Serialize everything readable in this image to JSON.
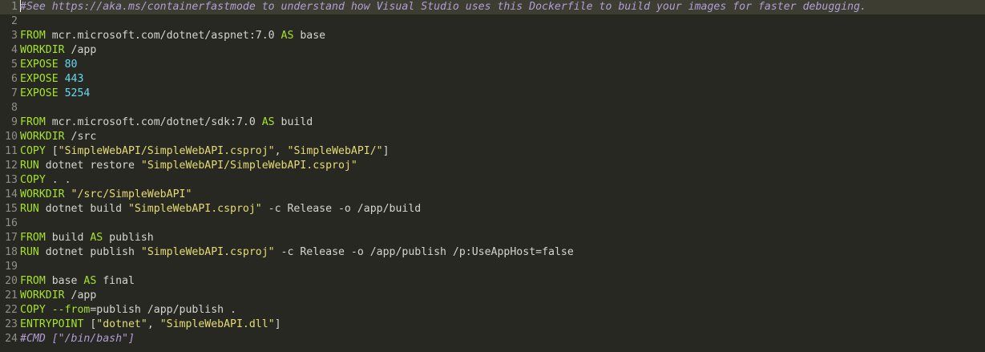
{
  "editor": {
    "language": "dockerfile",
    "current_line": 1,
    "colors": {
      "background": "#272822",
      "gutter_text": "#8f908a",
      "current_line_bg": "#3e3d32",
      "keyword": "#a6e22e",
      "string": "#e6db74",
      "number": "#66d9ef",
      "comment": "#b29ed6",
      "text": "#d5d5d0"
    },
    "lines": [
      {
        "n": "1",
        "tokens": [
          {
            "t": "cmt",
            "v": "#See https://aka.ms/containerfastmode to understand how Visual Studio uses this Dockerfile to build your images for faster debugging."
          }
        ]
      },
      {
        "n": "2",
        "tokens": []
      },
      {
        "n": "3",
        "tokens": [
          {
            "t": "kw",
            "v": "FROM"
          },
          {
            "t": "txt",
            "v": " mcr.microsoft.com/dotnet/aspnet:7.0 "
          },
          {
            "t": "kw",
            "v": "AS"
          },
          {
            "t": "txt",
            "v": " base"
          }
        ]
      },
      {
        "n": "4",
        "tokens": [
          {
            "t": "kw",
            "v": "WORKDIR"
          },
          {
            "t": "txt",
            "v": " /app"
          }
        ]
      },
      {
        "n": "5",
        "tokens": [
          {
            "t": "kw",
            "v": "EXPOSE"
          },
          {
            "t": "txt",
            "v": " "
          },
          {
            "t": "num",
            "v": "80"
          }
        ]
      },
      {
        "n": "6",
        "tokens": [
          {
            "t": "kw",
            "v": "EXPOSE"
          },
          {
            "t": "txt",
            "v": " "
          },
          {
            "t": "num",
            "v": "443"
          }
        ]
      },
      {
        "n": "7",
        "tokens": [
          {
            "t": "kw",
            "v": "EXPOSE"
          },
          {
            "t": "txt",
            "v": " "
          },
          {
            "t": "num",
            "v": "5254"
          }
        ]
      },
      {
        "n": "8",
        "tokens": []
      },
      {
        "n": "9",
        "tokens": [
          {
            "t": "kw",
            "v": "FROM"
          },
          {
            "t": "txt",
            "v": " mcr.microsoft.com/dotnet/sdk:7.0 "
          },
          {
            "t": "kw",
            "v": "AS"
          },
          {
            "t": "txt",
            "v": " build"
          }
        ]
      },
      {
        "n": "10",
        "tokens": [
          {
            "t": "kw",
            "v": "WORKDIR"
          },
          {
            "t": "txt",
            "v": " /src"
          }
        ]
      },
      {
        "n": "11",
        "tokens": [
          {
            "t": "kw",
            "v": "COPY"
          },
          {
            "t": "txt",
            "v": " ["
          },
          {
            "t": "str",
            "v": "\"SimpleWebAPI/SimpleWebAPI.csproj\""
          },
          {
            "t": "txt",
            "v": ", "
          },
          {
            "t": "str",
            "v": "\"SimpleWebAPI/\""
          },
          {
            "t": "txt",
            "v": "]"
          }
        ]
      },
      {
        "n": "12",
        "tokens": [
          {
            "t": "kw",
            "v": "RUN"
          },
          {
            "t": "txt",
            "v": " dotnet restore "
          },
          {
            "t": "str",
            "v": "\"SimpleWebAPI/SimpleWebAPI.csproj\""
          }
        ]
      },
      {
        "n": "13",
        "tokens": [
          {
            "t": "kw",
            "v": "COPY"
          },
          {
            "t": "txt",
            "v": " . ."
          }
        ]
      },
      {
        "n": "14",
        "tokens": [
          {
            "t": "kw",
            "v": "WORKDIR"
          },
          {
            "t": "txt",
            "v": " "
          },
          {
            "t": "str",
            "v": "\"/src/SimpleWebAPI\""
          }
        ]
      },
      {
        "n": "15",
        "tokens": [
          {
            "t": "kw",
            "v": "RUN"
          },
          {
            "t": "txt",
            "v": " dotnet build "
          },
          {
            "t": "str",
            "v": "\"SimpleWebAPI.csproj\""
          },
          {
            "t": "txt",
            "v": " -c Release -o /app/build"
          }
        ]
      },
      {
        "n": "16",
        "tokens": []
      },
      {
        "n": "17",
        "tokens": [
          {
            "t": "kw",
            "v": "FROM"
          },
          {
            "t": "txt",
            "v": " build "
          },
          {
            "t": "kw",
            "v": "AS"
          },
          {
            "t": "txt",
            "v": " publish"
          }
        ]
      },
      {
        "n": "18",
        "tokens": [
          {
            "t": "kw",
            "v": "RUN"
          },
          {
            "t": "txt",
            "v": " dotnet publish "
          },
          {
            "t": "str",
            "v": "\"SimpleWebAPI.csproj\""
          },
          {
            "t": "txt",
            "v": " -c Release -o /app/publish /p:UseAppHost=false"
          }
        ]
      },
      {
        "n": "19",
        "tokens": []
      },
      {
        "n": "20",
        "tokens": [
          {
            "t": "kw",
            "v": "FROM"
          },
          {
            "t": "txt",
            "v": " base "
          },
          {
            "t": "kw",
            "v": "AS"
          },
          {
            "t": "txt",
            "v": " final"
          }
        ]
      },
      {
        "n": "21",
        "tokens": [
          {
            "t": "kw",
            "v": "WORKDIR"
          },
          {
            "t": "txt",
            "v": " /app"
          }
        ]
      },
      {
        "n": "22",
        "tokens": [
          {
            "t": "kw",
            "v": "COPY"
          },
          {
            "t": "txt",
            "v": " "
          },
          {
            "t": "opt",
            "v": "--from"
          },
          {
            "t": "txt",
            "v": "=publish /app/publish ."
          }
        ]
      },
      {
        "n": "23",
        "tokens": [
          {
            "t": "kw",
            "v": "ENTRYPOINT"
          },
          {
            "t": "txt",
            "v": " ["
          },
          {
            "t": "str",
            "v": "\"dotnet\""
          },
          {
            "t": "txt",
            "v": ", "
          },
          {
            "t": "str",
            "v": "\"SimpleWebAPI.dll\""
          },
          {
            "t": "txt",
            "v": "]"
          }
        ]
      },
      {
        "n": "24",
        "tokens": [
          {
            "t": "cmt",
            "v": "#CMD [\"/bin/bash\"]"
          }
        ]
      }
    ]
  }
}
